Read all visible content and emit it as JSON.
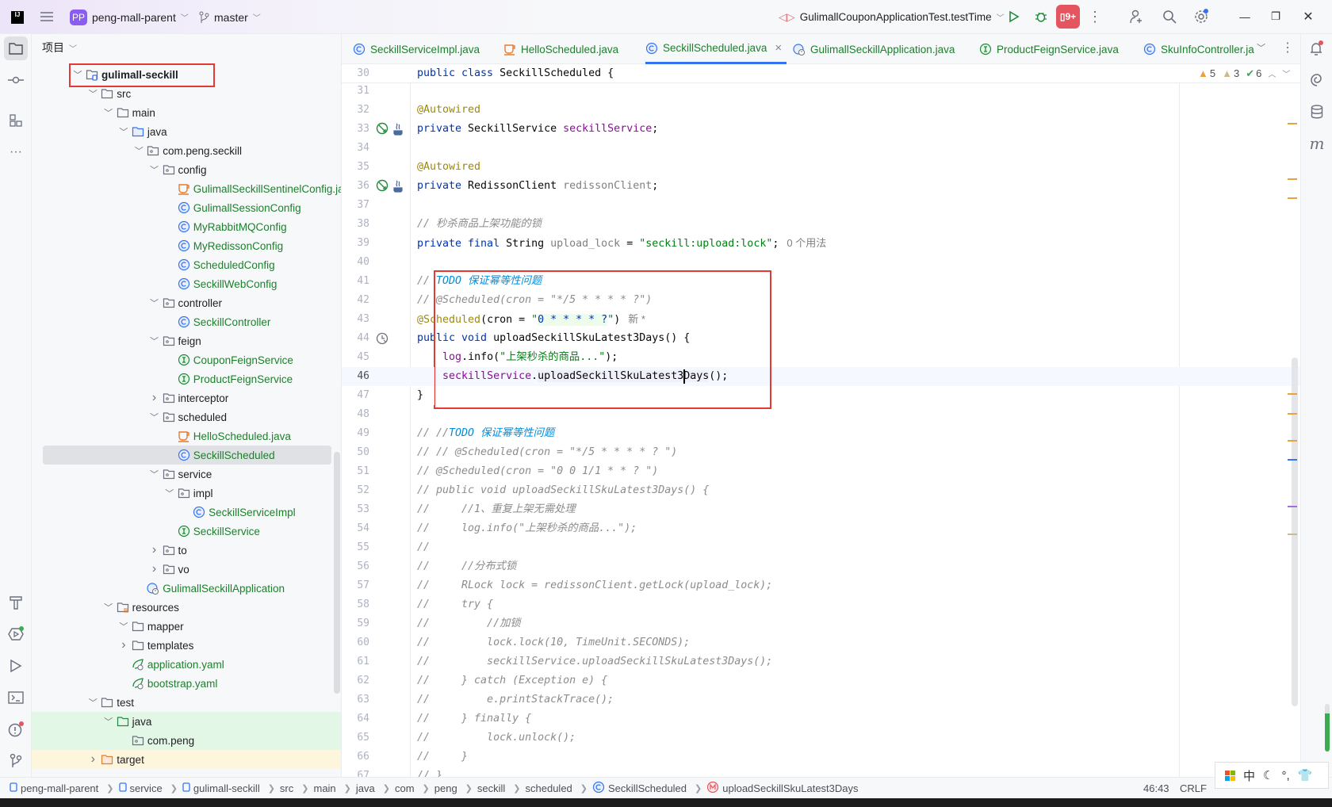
{
  "titlebar": {
    "project_badge": "PP",
    "project_name": "peng-mall-parent",
    "branch": "master",
    "run_config": "GulimallCouponApplicationTest.testTime",
    "icons": [
      "main-menu-icon",
      "run-icon",
      "debug-icon",
      "coverage-icon",
      "more-icon",
      "add-user-icon",
      "search-icon",
      "settings-icon",
      "minimize-icon",
      "restore-icon",
      "close-icon"
    ]
  },
  "project_panel": {
    "title": "项目",
    "items": [
      {
        "label": "gulimall-seckill",
        "depth": 0,
        "type": "module",
        "exp": true,
        "bold": true
      },
      {
        "label": "src",
        "depth": 1,
        "type": "folder",
        "exp": true
      },
      {
        "label": "main",
        "depth": 2,
        "type": "folder",
        "exp": true
      },
      {
        "label": "java",
        "depth": 3,
        "type": "src-folder",
        "exp": true
      },
      {
        "label": "com.peng.seckill",
        "depth": 4,
        "type": "package",
        "exp": true
      },
      {
        "label": "config",
        "depth": 5,
        "type": "package",
        "exp": true
      },
      {
        "label": "GulimallSeckillSentinelConfig.java",
        "depth": 6,
        "type": "java-file"
      },
      {
        "label": "GulimallSessionConfig",
        "depth": 6,
        "type": "class"
      },
      {
        "label": "MyRabbitMQConfig",
        "depth": 6,
        "type": "class"
      },
      {
        "label": "MyRedissonConfig",
        "depth": 6,
        "type": "class"
      },
      {
        "label": "ScheduledConfig",
        "depth": 6,
        "type": "class"
      },
      {
        "label": "SeckillWebConfig",
        "depth": 6,
        "type": "class"
      },
      {
        "label": "controller",
        "depth": 5,
        "type": "package",
        "exp": true
      },
      {
        "label": "SeckillController",
        "depth": 6,
        "type": "class"
      },
      {
        "label": "feign",
        "depth": 5,
        "type": "package",
        "exp": true
      },
      {
        "label": "CouponFeignService",
        "depth": 6,
        "type": "interface"
      },
      {
        "label": "ProductFeignService",
        "depth": 6,
        "type": "interface"
      },
      {
        "label": "interceptor",
        "depth": 5,
        "type": "package",
        "exp": false
      },
      {
        "label": "scheduled",
        "depth": 5,
        "type": "package",
        "exp": true
      },
      {
        "label": "HelloScheduled.java",
        "depth": 6,
        "type": "java-file"
      },
      {
        "label": "SeckillScheduled",
        "depth": 6,
        "type": "class",
        "selected": true
      },
      {
        "label": "service",
        "depth": 5,
        "type": "package",
        "exp": true
      },
      {
        "label": "impl",
        "depth": 6,
        "type": "package",
        "exp": true
      },
      {
        "label": "SeckillServiceImpl",
        "depth": 7,
        "type": "class"
      },
      {
        "label": "SeckillService",
        "depth": 6,
        "type": "interface"
      },
      {
        "label": "to",
        "depth": 5,
        "type": "package",
        "exp": false
      },
      {
        "label": "vo",
        "depth": 5,
        "type": "package",
        "exp": false
      },
      {
        "label": "GulimallSeckillApplication",
        "depth": 4,
        "type": "spring-app"
      },
      {
        "label": "resources",
        "depth": 2,
        "type": "res-folder",
        "exp": true
      },
      {
        "label": "mapper",
        "depth": 3,
        "type": "folder",
        "exp": true
      },
      {
        "label": "templates",
        "depth": 3,
        "type": "folder",
        "exp": false
      },
      {
        "label": "application.yaml",
        "depth": 3,
        "type": "yaml"
      },
      {
        "label": "bootstrap.yaml",
        "depth": 3,
        "type": "yaml"
      },
      {
        "label": "test",
        "depth": 1,
        "type": "folder",
        "exp": true
      },
      {
        "label": "java",
        "depth": 2,
        "type": "test-folder",
        "exp": true,
        "bg": "green"
      },
      {
        "label": "com.peng",
        "depth": 3,
        "type": "package",
        "bg": "green"
      },
      {
        "label": "target",
        "depth": 1,
        "type": "excluded-folder",
        "exp": false,
        "bg": "yellow"
      }
    ]
  },
  "tabs": [
    {
      "label": "SeckillServiceImpl.java",
      "icon": "class"
    },
    {
      "label": "HelloScheduled.java",
      "icon": "java-file"
    },
    {
      "label": "SeckillScheduled.java",
      "icon": "class",
      "active": true
    },
    {
      "label": "GulimallSeckillApplication.java",
      "icon": "spring-app"
    },
    {
      "label": "ProductFeignService.java",
      "icon": "interface"
    },
    {
      "label": "SkuInfoController.ja",
      "icon": "class"
    }
  ],
  "inspections": {
    "warnings": "5",
    "weak_warnings": "3",
    "ok": "6"
  },
  "editor": {
    "sticky": {
      "num": "30",
      "tokens": [
        {
          "c": "kw",
          "t": "public class "
        },
        {
          "c": "plain",
          "t": "SeckillScheduled {"
        }
      ]
    },
    "lines": [
      {
        "num": "31",
        "tokens": []
      },
      {
        "num": "32",
        "tokens": [
          {
            "c": "ann",
            "t": "@Autowired"
          }
        ]
      },
      {
        "num": "33",
        "gutter": "autowire",
        "tokens": [
          {
            "c": "kw",
            "t": "private "
          },
          {
            "c": "plain",
            "t": "SeckillService "
          },
          {
            "c": "field",
            "t": "seckillService"
          },
          {
            "c": "plain",
            "t": ";"
          }
        ]
      },
      {
        "num": "34",
        "tokens": []
      },
      {
        "num": "35",
        "tokens": [
          {
            "c": "ann",
            "t": "@Autowired"
          }
        ]
      },
      {
        "num": "36",
        "gutter": "autowire",
        "tokens": [
          {
            "c": "kw",
            "t": "private "
          },
          {
            "c": "plain",
            "t": "RedissonClient "
          },
          {
            "c": "gray",
            "t": "redissonClient"
          },
          {
            "c": "plain",
            "t": ";"
          }
        ]
      },
      {
        "num": "37",
        "tokens": []
      },
      {
        "num": "38",
        "tokens": [
          {
            "c": "cmt",
            "t": "// 秒杀商品上架功能的锁"
          }
        ]
      },
      {
        "num": "39",
        "tokens": [
          {
            "c": "kw",
            "t": "private final "
          },
          {
            "c": "plain",
            "t": "String "
          },
          {
            "c": "gray",
            "t": "upload_lock"
          },
          {
            "c": "plain",
            "t": " = "
          },
          {
            "c": "str",
            "t": "\"seckill:upload:lock\""
          },
          {
            "c": "plain",
            "t": ";"
          }
        ],
        "inlay": "0 个用法"
      },
      {
        "num": "40",
        "tokens": []
      },
      {
        "num": "41",
        "tokens": [
          {
            "c": "cmt",
            "t": "// "
          },
          {
            "c": "todo",
            "t": "TODO 保证幂等性问题"
          }
        ]
      },
      {
        "num": "42",
        "tokens": [
          {
            "c": "cmt",
            "t": "// @Scheduled(cron = \"*/5 * * * * ?\")"
          }
        ]
      },
      {
        "num": "43",
        "tokens": [
          {
            "c": "ann",
            "t": "@Scheduled"
          },
          {
            "c": "plain",
            "t": "(cron = "
          },
          {
            "c": "str",
            "t": "\""
          },
          {
            "c": "kw hlgreen",
            "t": "0 * * * * ?"
          },
          {
            "c": "str",
            "t": "\""
          },
          {
            "c": "plain",
            "t": ")"
          }
        ],
        "inlay": "新 *"
      },
      {
        "num": "44",
        "gutter": "clock",
        "tokens": [
          {
            "c": "kw",
            "t": "public void "
          },
          {
            "c": "plain",
            "t": "uploadSeckillSkuLatest3Days() {"
          }
        ]
      },
      {
        "num": "45",
        "tokens": [
          {
            "c": "plain",
            "t": "    "
          },
          {
            "c": "field",
            "t": "log"
          },
          {
            "c": "plain",
            "t": ".info("
          },
          {
            "c": "str",
            "t": "\"上架秒杀的商品...\""
          },
          {
            "c": "plain",
            "t": ");"
          }
        ]
      },
      {
        "num": "46",
        "current": true,
        "tokens": [
          {
            "c": "plain",
            "t": "    "
          },
          {
            "c": "field",
            "t": "seckillService"
          },
          {
            "c": "plain",
            "t": "."
          },
          {
            "c": "plain hlpurple",
            "t": "uploadSeckillSkuLatest3Days"
          },
          {
            "c": "plain",
            "t": "();"
          }
        ]
      },
      {
        "num": "47",
        "tokens": [
          {
            "c": "plain",
            "t": "}"
          }
        ]
      },
      {
        "num": "48",
        "tokens": []
      },
      {
        "num": "49",
        "tokens": [
          {
            "c": "cmt",
            "t": "// //"
          },
          {
            "c": "todo",
            "t": "TODO 保证幂等性问题"
          }
        ]
      },
      {
        "num": "50",
        "tokens": [
          {
            "c": "cmt",
            "t": "// // @Scheduled(cron = \"*/5 * * * * ? \")"
          }
        ]
      },
      {
        "num": "51",
        "tokens": [
          {
            "c": "cmt",
            "t": "// @Scheduled(cron = \"0 0 1/1 * * ? \")"
          }
        ]
      },
      {
        "num": "52",
        "tokens": [
          {
            "c": "cmt",
            "t": "// public void uploadSeckillSkuLatest3Days() {"
          }
        ]
      },
      {
        "num": "53",
        "tokens": [
          {
            "c": "cmt",
            "t": "//     //1、重复上架无需处理"
          }
        ]
      },
      {
        "num": "54",
        "tokens": [
          {
            "c": "cmt",
            "t": "//     log.info(\"上架秒杀的商品...\");"
          }
        ]
      },
      {
        "num": "55",
        "tokens": [
          {
            "c": "cmt",
            "t": "//"
          }
        ]
      },
      {
        "num": "56",
        "tokens": [
          {
            "c": "cmt",
            "t": "//     //分布式锁"
          }
        ]
      },
      {
        "num": "57",
        "tokens": [
          {
            "c": "cmt",
            "t": "//     RLock lock = redissonClient.getLock(upload_lock);"
          }
        ]
      },
      {
        "num": "58",
        "tokens": [
          {
            "c": "cmt",
            "t": "//     try {"
          }
        ]
      },
      {
        "num": "59",
        "tokens": [
          {
            "c": "cmt",
            "t": "//         //加锁"
          }
        ]
      },
      {
        "num": "60",
        "tokens": [
          {
            "c": "cmt",
            "t": "//         lock.lock(10, TimeUnit.SECONDS);"
          }
        ]
      },
      {
        "num": "61",
        "tokens": [
          {
            "c": "cmt",
            "t": "//         seckillService.uploadSeckillSkuLatest3Days();"
          }
        ]
      },
      {
        "num": "62",
        "tokens": [
          {
            "c": "cmt",
            "t": "//     } catch (Exception e) {"
          }
        ]
      },
      {
        "num": "63",
        "tokens": [
          {
            "c": "cmt",
            "t": "//         e.printStackTrace();"
          }
        ]
      },
      {
        "num": "64",
        "tokens": [
          {
            "c": "cmt",
            "t": "//     } finally {"
          }
        ]
      },
      {
        "num": "65",
        "tokens": [
          {
            "c": "cmt",
            "t": "//         lock.unlock();"
          }
        ]
      },
      {
        "num": "66",
        "tokens": [
          {
            "c": "cmt",
            "t": "//     }"
          }
        ]
      },
      {
        "num": "67",
        "tokens": [
          {
            "c": "cmt",
            "t": "// }"
          }
        ]
      }
    ]
  },
  "statusbar": {
    "breadcrumbs": [
      "peng-mall-parent",
      "service",
      "gulimall-seckill",
      "src",
      "main",
      "java",
      "com",
      "peng",
      "seckill",
      "scheduled",
      "SeckillScheduled",
      "uploadSeckillSkuLatest3Days"
    ],
    "position": "46:43",
    "line_ending": "CRLF",
    "ime": "中"
  },
  "colors": {
    "accent": "#3574f0",
    "highlight_box": "#e53935",
    "vcs_added": "#1d7f2c"
  }
}
